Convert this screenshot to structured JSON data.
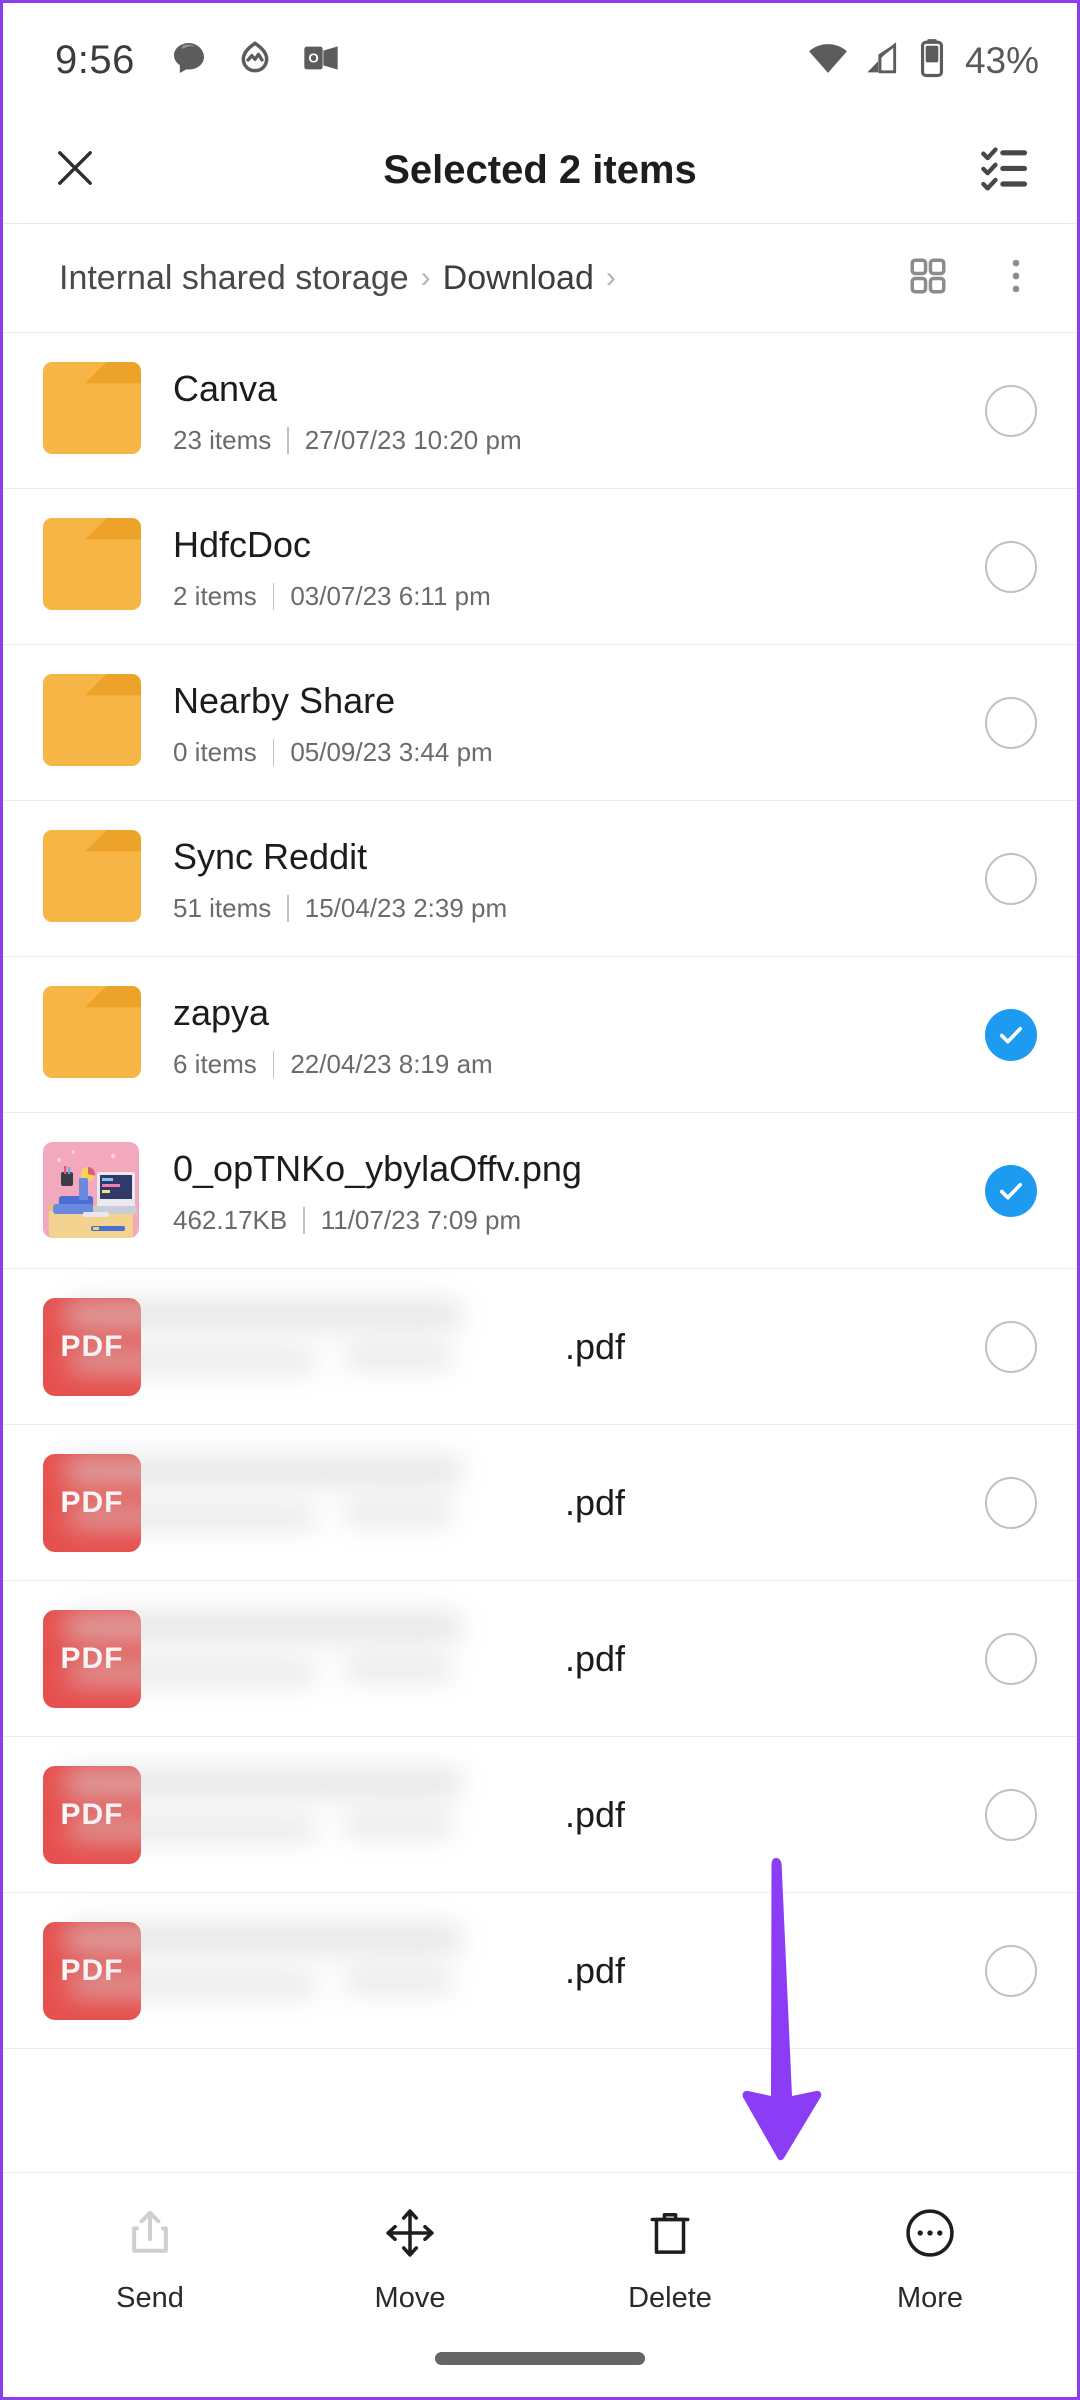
{
  "status_bar": {
    "time": "9:56",
    "battery_percent": "43%",
    "notification_icons": [
      "chat-bubble-icon",
      "fitness-circle-icon",
      "outlook-icon"
    ],
    "right_icons": [
      "wifi-icon",
      "cellular-signal-icon",
      "battery-icon"
    ]
  },
  "app_bar": {
    "close_label": "close-icon",
    "title": "Selected 2 items",
    "select_all_label": "select-all-icon"
  },
  "breadcrumb": {
    "root": "Internal shared storage",
    "separator": "›",
    "current": "Download",
    "grid_view_icon": "grid-view-icon",
    "overflow_icon": "overflow-menu-icon"
  },
  "files": [
    {
      "name": "Canva",
      "type": "folder",
      "meta1": "23 items",
      "meta2": "27/07/23 10:20 pm",
      "selected": false
    },
    {
      "name": "HdfcDoc",
      "type": "folder",
      "meta1": "2 items",
      "meta2": "03/07/23 6:11 pm",
      "selected": false
    },
    {
      "name": "Nearby Share",
      "type": "folder",
      "meta1": "0 items",
      "meta2": "05/09/23 3:44 pm",
      "selected": false
    },
    {
      "name": "Sync Reddit",
      "type": "folder",
      "meta1": "51 items",
      "meta2": "15/04/23 2:39 pm",
      "selected": false
    },
    {
      "name": "zapya",
      "type": "folder",
      "meta1": "6 items",
      "meta2": "22/04/23 8:19 am",
      "selected": true
    },
    {
      "name": "0_opTNKo_ybylaOffv.png",
      "type": "image",
      "meta1": "462.17KB",
      "meta2": "11/07/23 7:09 pm",
      "selected": true
    },
    {
      "name": ".pdf",
      "type": "pdf",
      "redacted": true,
      "meta1": "",
      "meta2": "",
      "selected": false
    },
    {
      "name": ".pdf",
      "type": "pdf",
      "redacted": true,
      "meta1": "",
      "meta2": "",
      "selected": false
    },
    {
      "name": ".pdf",
      "type": "pdf",
      "redacted": true,
      "meta1": "",
      "meta2": "",
      "selected": false
    },
    {
      "name": ".pdf",
      "type": "pdf",
      "redacted": true,
      "meta1": "",
      "meta2": "",
      "selected": false
    },
    {
      "name": ".pdf",
      "type": "pdf",
      "redacted": true,
      "meta1": "",
      "meta2": "",
      "selected": false
    }
  ],
  "bottom_toolbar": [
    {
      "label": "Send",
      "icon": "share-upload-icon"
    },
    {
      "label": "Move",
      "icon": "move-arrows-icon"
    },
    {
      "label": "Delete",
      "icon": "trash-icon"
    },
    {
      "label": "More",
      "icon": "more-circle-icon"
    }
  ],
  "annotation": {
    "type": "arrow-down",
    "points_to": "More",
    "color": "#8b3df5"
  },
  "colors": {
    "folder": "#f6b545",
    "pdf_badge": "#e6504e",
    "checked": "#1d9bf0",
    "annotation": "#8b3df5",
    "frame": "#8b3df5"
  },
  "pdf_badge_text": "PDF"
}
